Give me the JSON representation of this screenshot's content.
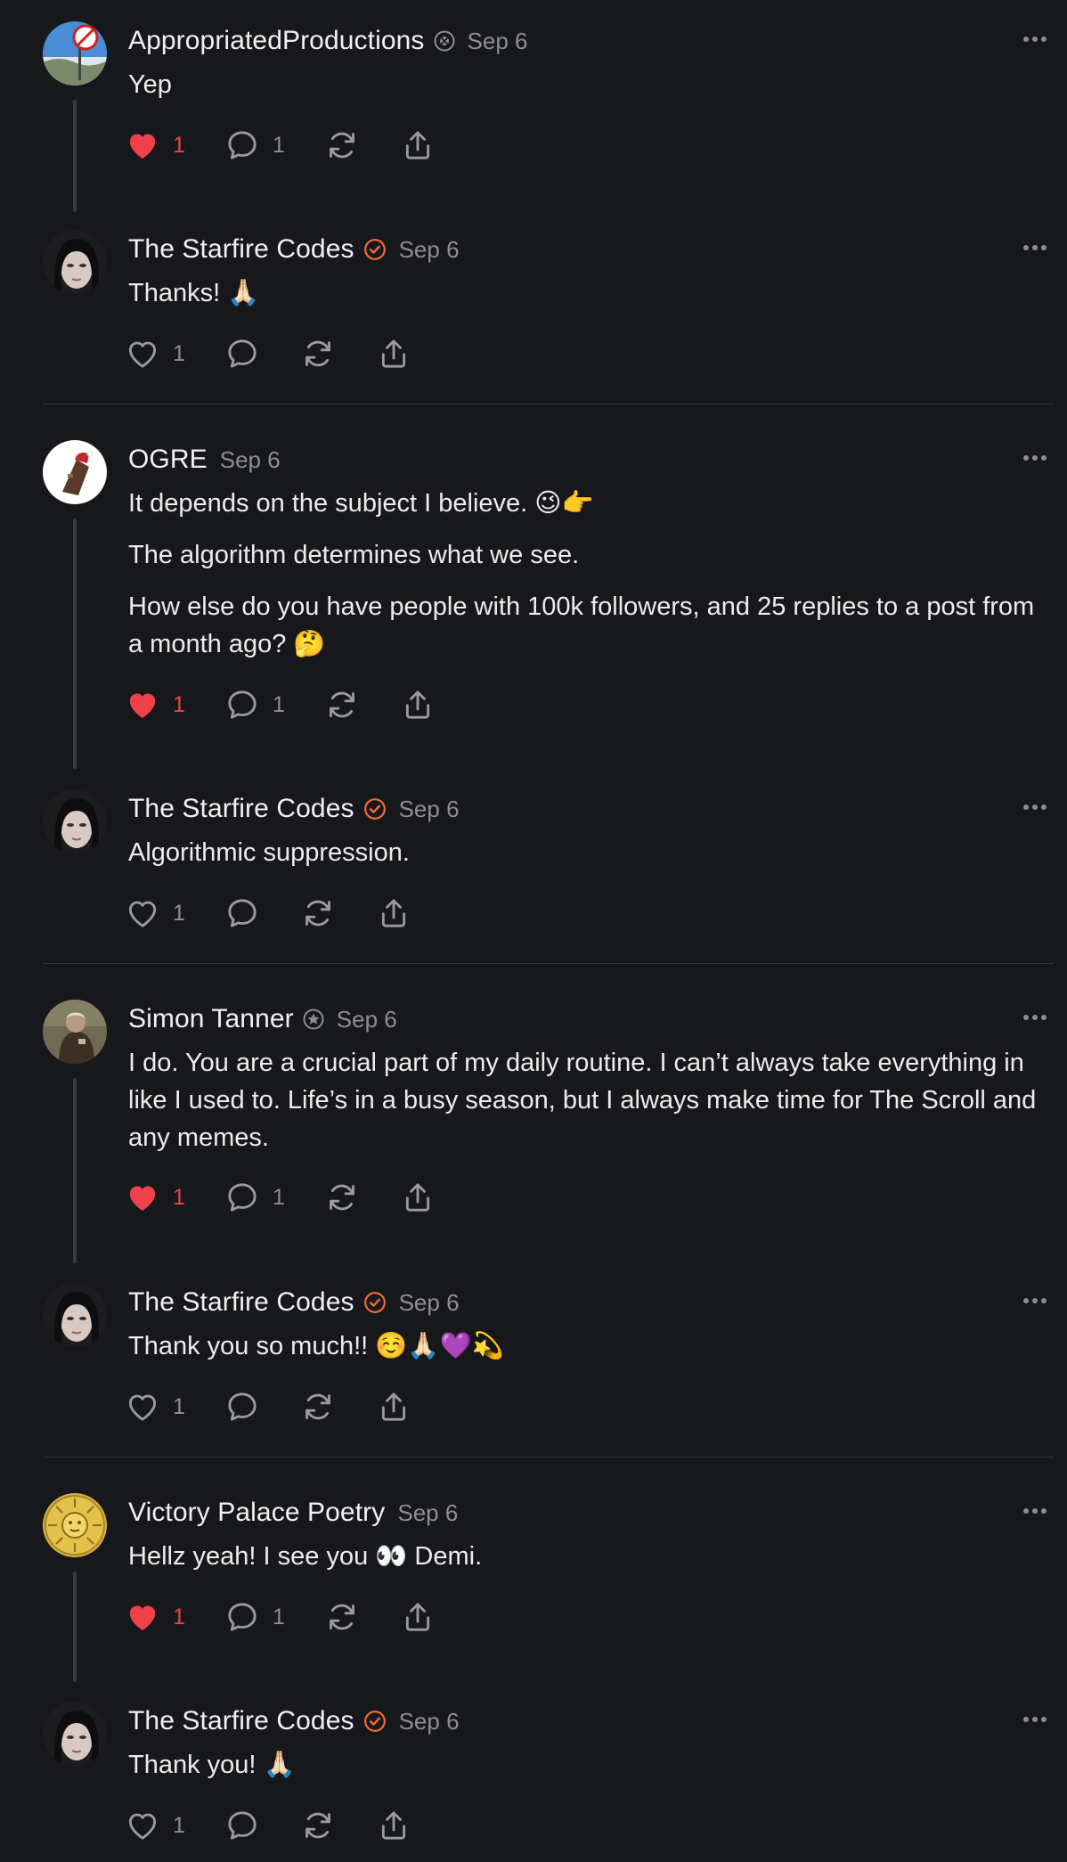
{
  "colors": {
    "background": "#17181b",
    "like_red": "#f0414b",
    "verified_orange": "#f26d35",
    "muted": "#8d8e93"
  },
  "posts": [
    {
      "author": "AppropriatedProductions",
      "badge": "profile-badge-icon",
      "date": "Sep 6",
      "paragraphs": [
        "Yep"
      ],
      "liked": true,
      "likes": "1",
      "replies": "1"
    },
    {
      "author": "The Starfire Codes",
      "badge": "verified-check-icon",
      "date": "Sep 6",
      "paragraphs": [
        "Thanks! 🙏🏻"
      ],
      "liked": false,
      "likes": "1",
      "replies": ""
    },
    {
      "author": "OGRE",
      "badge": "",
      "date": "Sep 6",
      "paragraphs": [
        "It depends on the subject I believe. 😉👉",
        "The algorithm determines what we see.",
        "How else do you have people with 100k followers, and 25 replies to a post from a month ago? 🤔"
      ],
      "liked": true,
      "likes": "1",
      "replies": "1"
    },
    {
      "author": "The Starfire Codes",
      "badge": "verified-check-icon",
      "date": "Sep 6",
      "paragraphs": [
        "Algorithmic suppression."
      ],
      "liked": false,
      "likes": "1",
      "replies": ""
    },
    {
      "author": "Simon Tanner",
      "badge": "profile-badge-icon",
      "date": "Sep 6",
      "paragraphs": [
        "I do. You are a crucial part of my daily routine. I can’t always take everything in like I used to. Life’s in a busy season, but I always make time for The Scroll and any memes."
      ],
      "liked": true,
      "likes": "1",
      "replies": "1"
    },
    {
      "author": "The Starfire Codes",
      "badge": "verified-check-icon",
      "date": "Sep 6",
      "paragraphs": [
        "Thank you so much!! ☺️🙏🏻💜💫"
      ],
      "liked": false,
      "likes": "1",
      "replies": ""
    },
    {
      "author": "Victory Palace Poetry",
      "badge": "",
      "date": "Sep 6",
      "paragraphs": [
        "Hellz yeah! I see you 👀 Demi."
      ],
      "liked": true,
      "likes": "1",
      "replies": "1"
    },
    {
      "author": "The Starfire Codes",
      "badge": "verified-check-icon",
      "date": "Sep 6",
      "paragraphs": [
        "Thank you! 🙏🏻"
      ],
      "liked": false,
      "likes": "1",
      "replies": ""
    }
  ]
}
